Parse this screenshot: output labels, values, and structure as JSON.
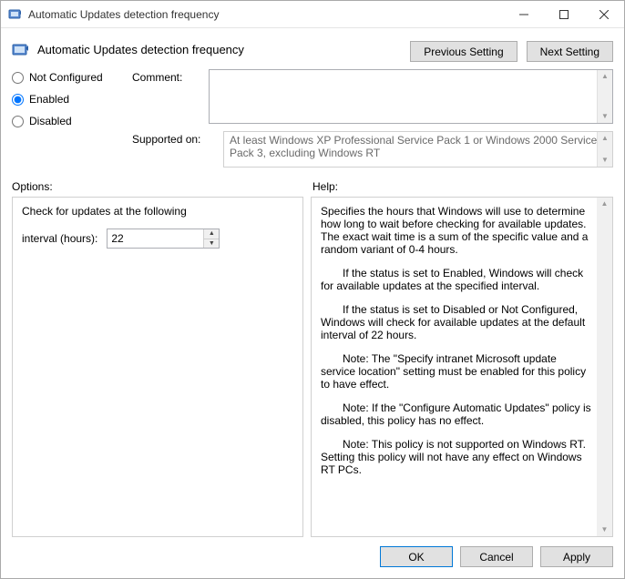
{
  "window": {
    "title": "Automatic Updates detection frequency"
  },
  "header": {
    "title": "Automatic Updates detection frequency",
    "prev_button": "Previous Setting",
    "next_button": "Next Setting"
  },
  "state": {
    "radios": {
      "not_configured": "Not Configured",
      "enabled": "Enabled",
      "disabled": "Disabled",
      "selected": "enabled"
    },
    "comment_label": "Comment:",
    "comment_value": "",
    "supported_label": "Supported on:",
    "supported_value": "At least Windows XP Professional Service Pack 1 or Windows 2000 Service Pack 3, excluding Windows RT"
  },
  "sections": {
    "options_label": "Options:",
    "help_label": "Help:"
  },
  "options": {
    "line1": "Check for updates at the following",
    "interval_label": "interval (hours):",
    "interval_value": "22"
  },
  "help": {
    "p1": "Specifies the hours that Windows will use to determine how long to wait before checking for available updates. The exact wait time is a sum of the specific value and a random variant of 0-4 hours.",
    "p2": "If the status is set to Enabled, Windows will check for available updates at the specified interval.",
    "p3": "If the status is set to Disabled or Not Configured, Windows will check for available updates at the default interval of 22 hours.",
    "p4": "Note: The \"Specify intranet Microsoft update service location\" setting must be enabled for this policy to have effect.",
    "p5": "Note: If the \"Configure Automatic Updates\" policy is disabled, this policy has no effect.",
    "p6": "Note: This policy is not supported on Windows RT. Setting this policy will not have any effect on Windows RT PCs."
  },
  "footer": {
    "ok": "OK",
    "cancel": "Cancel",
    "apply": "Apply"
  }
}
